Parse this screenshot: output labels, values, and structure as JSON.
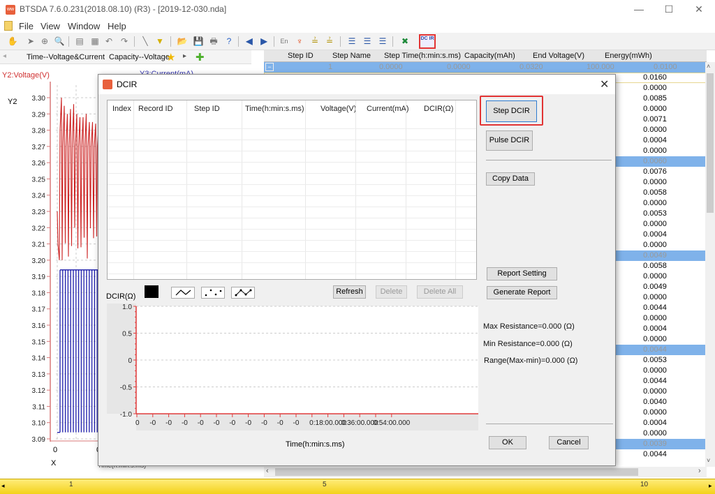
{
  "window": {
    "title": "BTSDA 7.6.0.231(2018.08.10) (R3) - [2019-12-030.nda]",
    "minimize": "—",
    "maximize": "☐",
    "close": "✕"
  },
  "menu": {
    "items": [
      {
        "label": "File"
      },
      {
        "label": "View"
      },
      {
        "label": "Window"
      },
      {
        "label": "Help"
      }
    ],
    "mdi": [
      "_",
      "▭",
      "✕"
    ]
  },
  "toolbar": {
    "icons": [
      "hand-icon",
      "pointer-icon",
      "zoom-area-icon",
      "zoom-icon",
      "chart-icon",
      "copy-chart-icon",
      "undo-icon",
      "redo-icon",
      "line-icon",
      "filter-icon",
      "open-folder-icon",
      "save-icon",
      "print-icon",
      "help-icon",
      "arrow-left-icon",
      "arrow-right-icon",
      "english-icon",
      "pin-icon",
      "layer-up-icon",
      "layer-down-icon",
      "list-icon",
      "list-detail-icon",
      "list-step-icon",
      "excel-icon"
    ],
    "dcir_label": "DC IR"
  },
  "chart_tabs": [
    {
      "label": "Time--Voltage&Current"
    },
    {
      "label": "Capacity--Voltage"
    }
  ],
  "left_chart": {
    "y2_title": "Y2:Voltage(V)",
    "y2_axis": "Y2",
    "y3_title": "Y3:Current(mA)",
    "x_axis": "X",
    "x_title": "Time(h:min:s.ms)",
    "y_ticks": [
      "3.30",
      "3.29",
      "3.28",
      "3.27",
      "3.26",
      "3.25",
      "3.24",
      "3.23",
      "3.22",
      "3.21",
      "3.20",
      "3.19",
      "3.18",
      "3.17",
      "3.16",
      "3.15",
      "3.14",
      "3.13",
      "3.12",
      "3.11",
      "3.10",
      "3.09"
    ],
    "x_ticks": [
      "0",
      "0"
    ],
    "voltage_color": "#cc2222",
    "current_color": "#1a1aaa"
  },
  "grid": {
    "columns": [
      "Step ID",
      "Step Name",
      "Step Time(h:min:s.ms)",
      "Capacity(mAh)",
      "End Voltage(V)",
      "Energy(mWh)"
    ],
    "selected_row": {
      "step_id": "1",
      "c2": "0.0000",
      "c3": "0.0000",
      "c4": "0.0320",
      "c5": "100.000",
      "c6": "0.0100"
    },
    "energy_values": [
      "0.0160",
      "0.0000",
      "0.0085",
      "0.0000",
      "0.0071",
      "0.0000",
      "0.0004",
      "0.0000",
      "0.0060",
      "0.0076",
      "0.0000",
      "0.0058",
      "0.0000",
      "0.0053",
      "0.0000",
      "0.0004",
      "0.0000",
      "0.0049",
      "0.0058",
      "0.0000",
      "0.0049",
      "0.0000",
      "0.0044",
      "0.0000",
      "0.0004",
      "0.0000",
      "0.0044",
      "0.0053",
      "0.0000",
      "0.0044",
      "0.0000",
      "0.0040",
      "0.0000",
      "0.0004",
      "0.0000",
      "0.0039",
      "0.0044"
    ],
    "group_rows": [
      8,
      17,
      26,
      35
    ]
  },
  "timeline": {
    "labels": [
      "1",
      "5",
      "10"
    ]
  },
  "dialog": {
    "title": "DCIR",
    "close": "✕",
    "table": {
      "columns": [
        "Index",
        "Record ID",
        "Step ID",
        "Time(h:min:s.ms)",
        "Voltage(V)",
        "Current(mA)",
        "DCIR(Ω)"
      ],
      "rows": []
    },
    "buttons": {
      "step_dcir": "Step DCIR",
      "pulse_dcir": "Pulse DCIR",
      "copy_data": "Copy Data",
      "report_setting": "Report Setting",
      "generate_report": "Generate Report",
      "refresh": "Refresh",
      "delete": "Delete",
      "delete_all": "Delete All",
      "ok": "OK",
      "cancel": "Cancel"
    },
    "stats": {
      "max": "Max Resistance=0.000 (Ω)",
      "min": "Min Resistance=0.000 (Ω)",
      "range": "Range(Max-min)=0.000 (Ω)"
    },
    "chart_label": "DCIR(Ω)",
    "series_color": "#000000"
  },
  "chart_data": {
    "type": "line",
    "title": "",
    "ylabel": "DCIR(Ω)",
    "xlabel": "Time(h:min:s.ms)",
    "ylim": [
      -1.0,
      1.0
    ],
    "y_ticks": [
      "1.0",
      "0.5",
      "0",
      "-0.5",
      "-1.0"
    ],
    "x_ticks": [
      "0",
      "-0",
      "-0",
      "-0",
      "-0",
      "-0",
      "-0",
      "-0",
      "-0",
      "-0",
      "-0",
      "",
      "0:18:00.000",
      "",
      "0:36:00.000",
      "",
      "0:54:00.000"
    ],
    "series": [],
    "grid": true,
    "axis_color": "#e03c3c"
  }
}
